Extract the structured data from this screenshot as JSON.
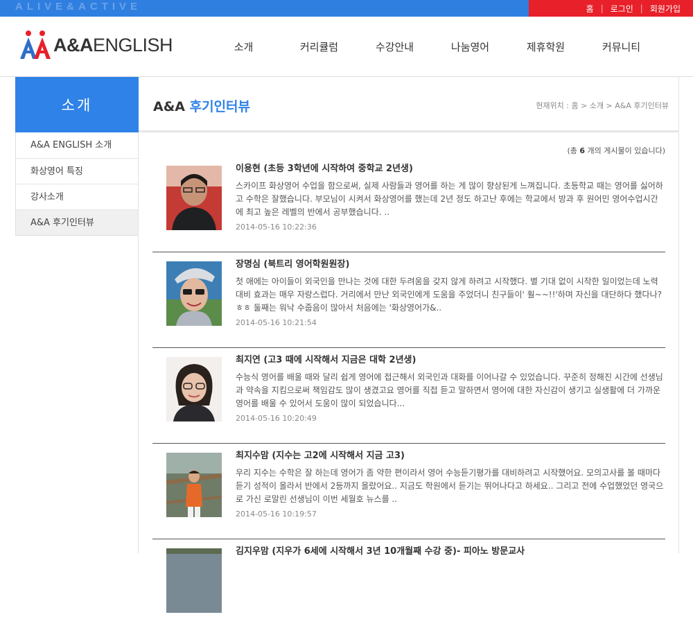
{
  "topbar": {
    "slogan": "ALIVE&ACTIVE",
    "links": [
      "홈",
      "로그인",
      "회원가입"
    ]
  },
  "logo": {
    "text_bold": "A&A",
    "text": "ENGLISH"
  },
  "gnb": [
    "소개",
    "커리큘럼",
    "수강안내",
    "나눔영어",
    "제휴학원",
    "커뮤니티"
  ],
  "sidebar": {
    "title": "소개",
    "items": [
      "A&A ENGLISH 소개",
      "화상영어 특징",
      "강사소개",
      "A&A 후기인터뷰"
    ]
  },
  "content": {
    "title_prefix": "A&A",
    "title_main": "후기인터뷰",
    "breadcrumb": "현재위치 : 홈 > 소개 > A&A 후기인터뷰",
    "count_prefix": "(총",
    "count_value": "6",
    "count_suffix": "개의 게시물이 있습니다)"
  },
  "posts": [
    {
      "title": "이용현 (초등 3학년에 시작하여 중학교 2년생)",
      "desc": "스카이프 화상영어 수업을 함으로써, 실제 사람들과 영어를 하는 게 많이 향상된게 느껴집니다. 초등학교 때는 영어를 싫어하고 수학은 잘했습니다. 부모님이 시켜서 화상영어를 했는데 2년 정도 하고난 후에는 학교에서 방과 후 원어민 영어수업시간에 최고 높은 레벨의 반에서 공부했습니다. ..",
      "date": "2014-05-16 10:22:36"
    },
    {
      "title": "장명심 (북트리 영어학원원장)",
      "desc": "첫 애에는 아이들이 외국인을 만나는 것에 대한 두려움을 갖지 않게 하려고 시작했다. 별 기대 없이 시작한 일이었는데 노력대비 효과는 매우 자랑스럽다. 거리에서 만난 외국인에게 도움을 주었더니 친구들이' 훨~~!!'하며 자신을 대단하다 했다나? ㅎㅎ 둘째는 워낙 수줍음이 많아서 처음에는 '화상영어가&..",
      "date": "2014-05-16 10:21:54"
    },
    {
      "title": "최지연 (고3 때에 시작해서 지금은 대학 2년생)",
      "desc": "수능식 영어를 배울 때와 달리 쉽게 영어에 접근해서 외국인과 대화를 이어나갈 수 있었습니다. 꾸준히 정해진 시간에 선생님과 약속을 지킴으로써 책임감도 많이 생겼고요 영어를 직접 듣고 말하면서 영어에 대한 자신감이 생기고 실생활에 더 가까운 영어를 배울 수 있어서 도움이 많이 되었습니다...",
      "date": "2014-05-16 10:20:49"
    },
    {
      "title": "최지수맘 (지수는 고2에 시작해서 지금 고3)",
      "desc": "우리 지수는 수학은 잘 하는데 영어가 좀 약한 편이라서 영어 수능듣기평가를 대비하려고 시작했어요. 모의고사를 볼 때마다 듣기 성적이 올라서 반에서 2등까지 올랐어요.. 지금도 학원에서 듣기는 뛰어나다고 하세요.. 그리고 전에 수업했었던 영국으로 가신 로말린 선생님이 이번 세월호 뉴스를 ..",
      "date": "2014-05-16 10:19:57"
    },
    {
      "title": "김지우맘 (지우가 6세에 시작해서 3년 10개월째 수강 중)- 피아노 방문교사",
      "desc": "",
      "date": ""
    }
  ]
}
